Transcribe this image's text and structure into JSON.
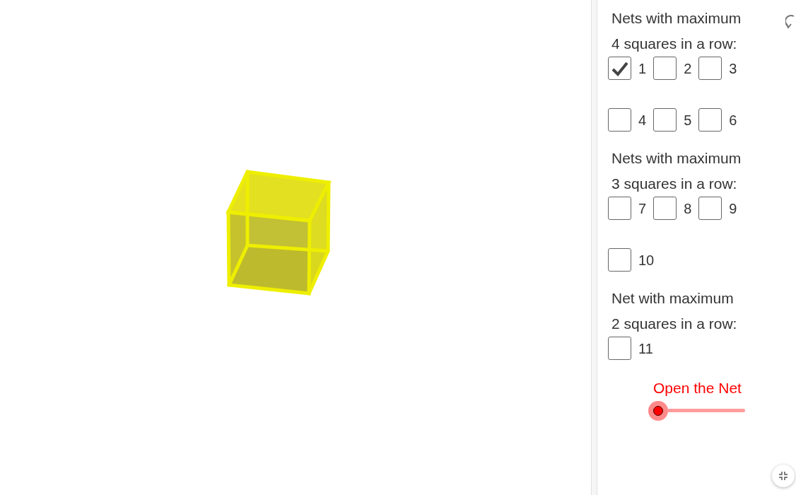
{
  "sections": [
    {
      "heading_lines": [
        "Nets with maximum",
        "4 squares in a row:"
      ],
      "rows": [
        [
          {
            "label": "1",
            "checked": true
          },
          {
            "label": "2",
            "checked": false
          },
          {
            "label": "3",
            "checked": false
          }
        ],
        [
          {
            "label": "4",
            "checked": false
          },
          {
            "label": "5",
            "checked": false
          },
          {
            "label": "6",
            "checked": false
          }
        ]
      ]
    },
    {
      "heading_lines": [
        "Nets with maximum",
        "3 squares in a row:"
      ],
      "rows": [
        [
          {
            "label": "7",
            "checked": false
          },
          {
            "label": "8",
            "checked": false
          },
          {
            "label": "9",
            "checked": false
          }
        ],
        [
          {
            "label": "10",
            "checked": false
          }
        ]
      ]
    },
    {
      "heading_lines": [
        "Net with maximum",
        "2 squares in a row:"
      ],
      "rows": [
        [
          {
            "label": "11",
            "checked": false
          }
        ]
      ]
    }
  ],
  "slider": {
    "label": "Open the Net",
    "level": 0
  }
}
